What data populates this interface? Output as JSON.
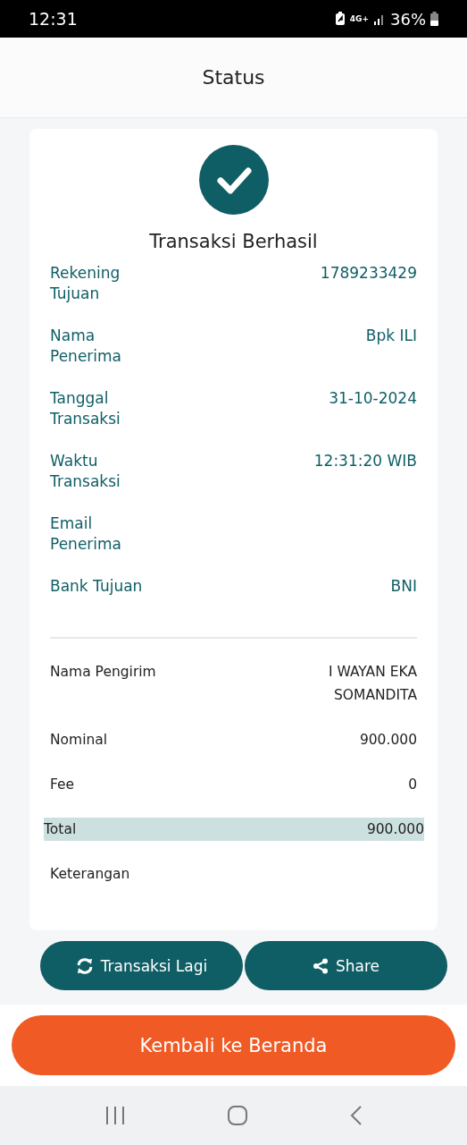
{
  "status_bar": {
    "time": "12:31",
    "network": "4G+",
    "battery": "36%"
  },
  "header": {
    "title": "Status"
  },
  "result": {
    "title": "Transaksi Berhasil"
  },
  "recipient_details": [
    {
      "label": "Rekening Tujuan",
      "value": "1789233429"
    },
    {
      "label": "Nama Penerima",
      "value": "Bpk ILI"
    },
    {
      "label": "Tanggal Transaksi",
      "value": "31-10-2024"
    },
    {
      "label": "Waktu Transaksi",
      "value": "12:31:20 WIB"
    },
    {
      "label": "Email Penerima"
    },
    {
      "label": "Bank Tujuan",
      "value": "BNI"
    }
  ],
  "sender_details": [
    {
      "label": "Nama Pengirim",
      "value": "I WAYAN EKA SOMANDITA",
      "highlighted": false
    },
    {
      "label": "Nominal",
      "value": "900.000",
      "highlighted": false
    },
    {
      "label": "Fee",
      "value": "0",
      "highlighted": false
    },
    {
      "label": "Total",
      "value": "900.000",
      "highlighted": true
    },
    {
      "label": "Keterangan",
      "highlighted": false
    }
  ],
  "actions": [
    {
      "kind": "repeat",
      "label": "Transaksi Lagi"
    },
    {
      "kind": "share",
      "label": "Share"
    }
  ],
  "home_button": {
    "label": "Kembali ke Beranda"
  }
}
